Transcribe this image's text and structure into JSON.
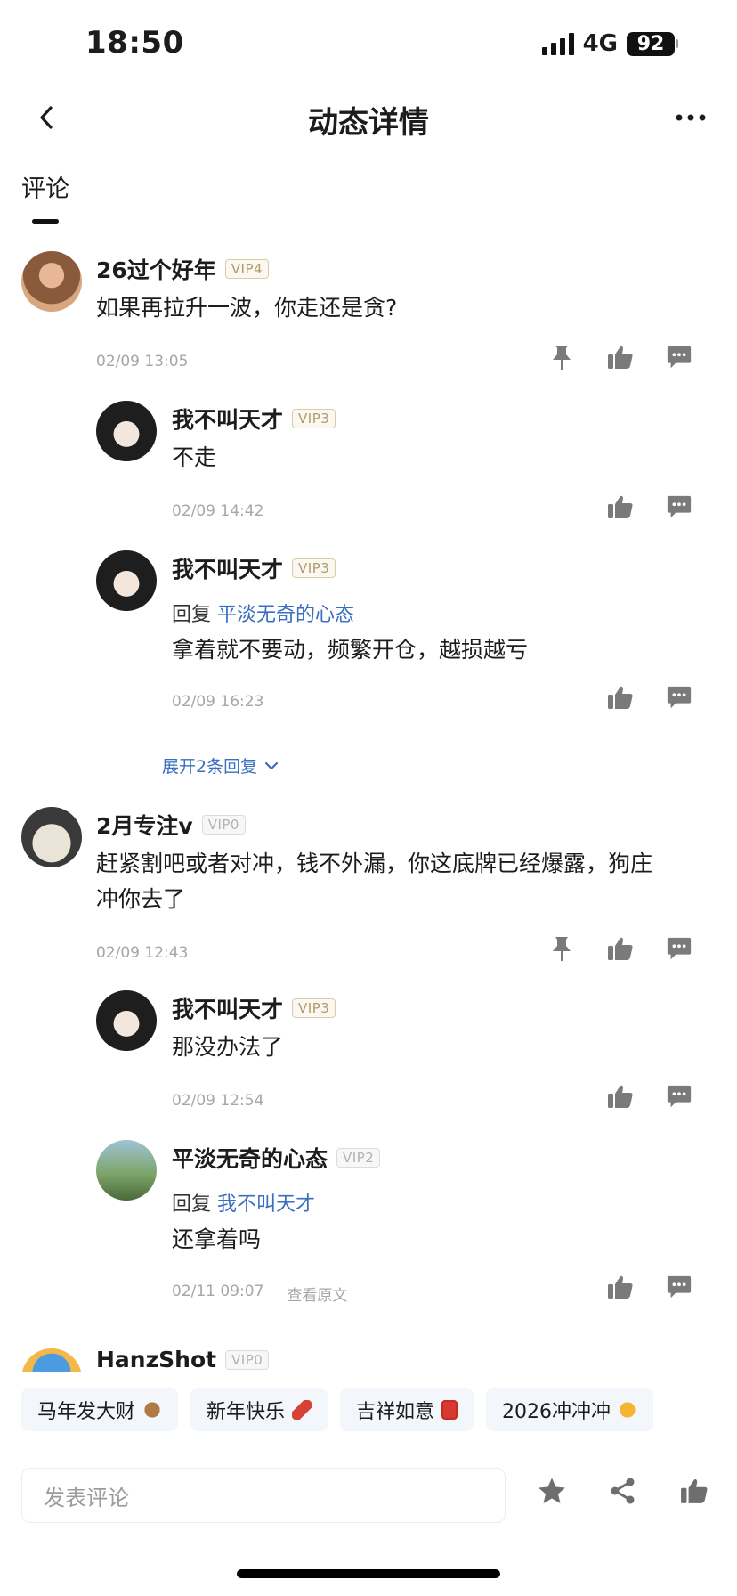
{
  "status_bar": {
    "time": "18:50",
    "network": "4G",
    "battery": "92"
  },
  "nav": {
    "title": "动态详情"
  },
  "tab": {
    "label": "评论"
  },
  "comments": [
    {
      "user": "26过个好年",
      "vip": "VIP4",
      "text": "如果再拉升一波，你走还是贪?",
      "time": "02/09 13:05",
      "replies": [
        {
          "user": "我不叫天才",
          "vip": "VIP3",
          "text": "不走",
          "time": "02/09 14:42"
        },
        {
          "user": "我不叫天才",
          "vip": "VIP3",
          "reply_prefix": "回复",
          "reply_to": "平淡无奇的心态",
          "text": "拿着就不要动，频繁开仓，越损越亏",
          "time": "02/09 16:23"
        }
      ],
      "expand_label": "展开2条回复"
    },
    {
      "user": "2月专注v",
      "vip": "VIP0",
      "text_line1": "赶紧割吧或者对冲，钱不外漏，你这底牌已经爆露，狗庄",
      "text_line2": "冲你去了",
      "time": "02/09 12:43",
      "replies": [
        {
          "user": "我不叫天才",
          "vip": "VIP3",
          "text": "那没办法了",
          "time": "02/09 12:54"
        },
        {
          "user": "平淡无奇的心态",
          "vip": "VIP2",
          "reply_prefix": "回复",
          "reply_to": "我不叫天才",
          "text": "还拿着吗",
          "time": "02/11 09:07",
          "view_original": "查看原文"
        }
      ]
    },
    {
      "user": "HanzShot",
      "vip": "VIP0"
    }
  ],
  "quick_replies": [
    {
      "label": "马年发大财",
      "icon": "horse-emoji"
    },
    {
      "label": "新年快乐",
      "icon": "firecracker-emoji"
    },
    {
      "label": "吉祥如意",
      "icon": "red-envelope-emoji"
    },
    {
      "label": "2026冲冲冲",
      "icon": "fist-emoji"
    }
  ],
  "input": {
    "placeholder": "发表评论"
  },
  "colors": {
    "link": "#3a6fbf",
    "vip_gold": "#b09a6a",
    "icon_gray": "#7a7a7a"
  }
}
